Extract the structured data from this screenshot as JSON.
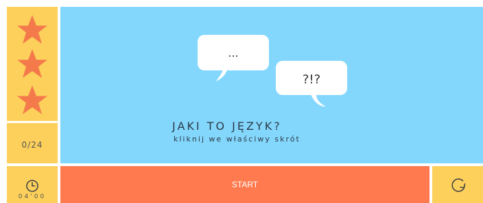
{
  "stars": [
    {
      "icon": "star-icon",
      "color": "#f47a4c"
    },
    {
      "icon": "star-icon",
      "color": "#f47a4c"
    },
    {
      "icon": "star-icon",
      "color": "#f47a4c"
    }
  ],
  "score": {
    "text": "0/24"
  },
  "timer": {
    "icon": "clock-icon",
    "text": "04'00"
  },
  "bubbles": {
    "first": "...",
    "second": "?!?"
  },
  "main": {
    "title": "JAKI TO JĘZYK?",
    "subtitle": "kliknij we właściwy skrót"
  },
  "controls": {
    "start_label": "START",
    "restart_icon": "restart-icon"
  },
  "colors": {
    "panel_yellow": "#fcd05b",
    "main_blue": "#84d7fc",
    "start_orange": "#ff7a4f",
    "star_orange": "#f47a4c"
  }
}
